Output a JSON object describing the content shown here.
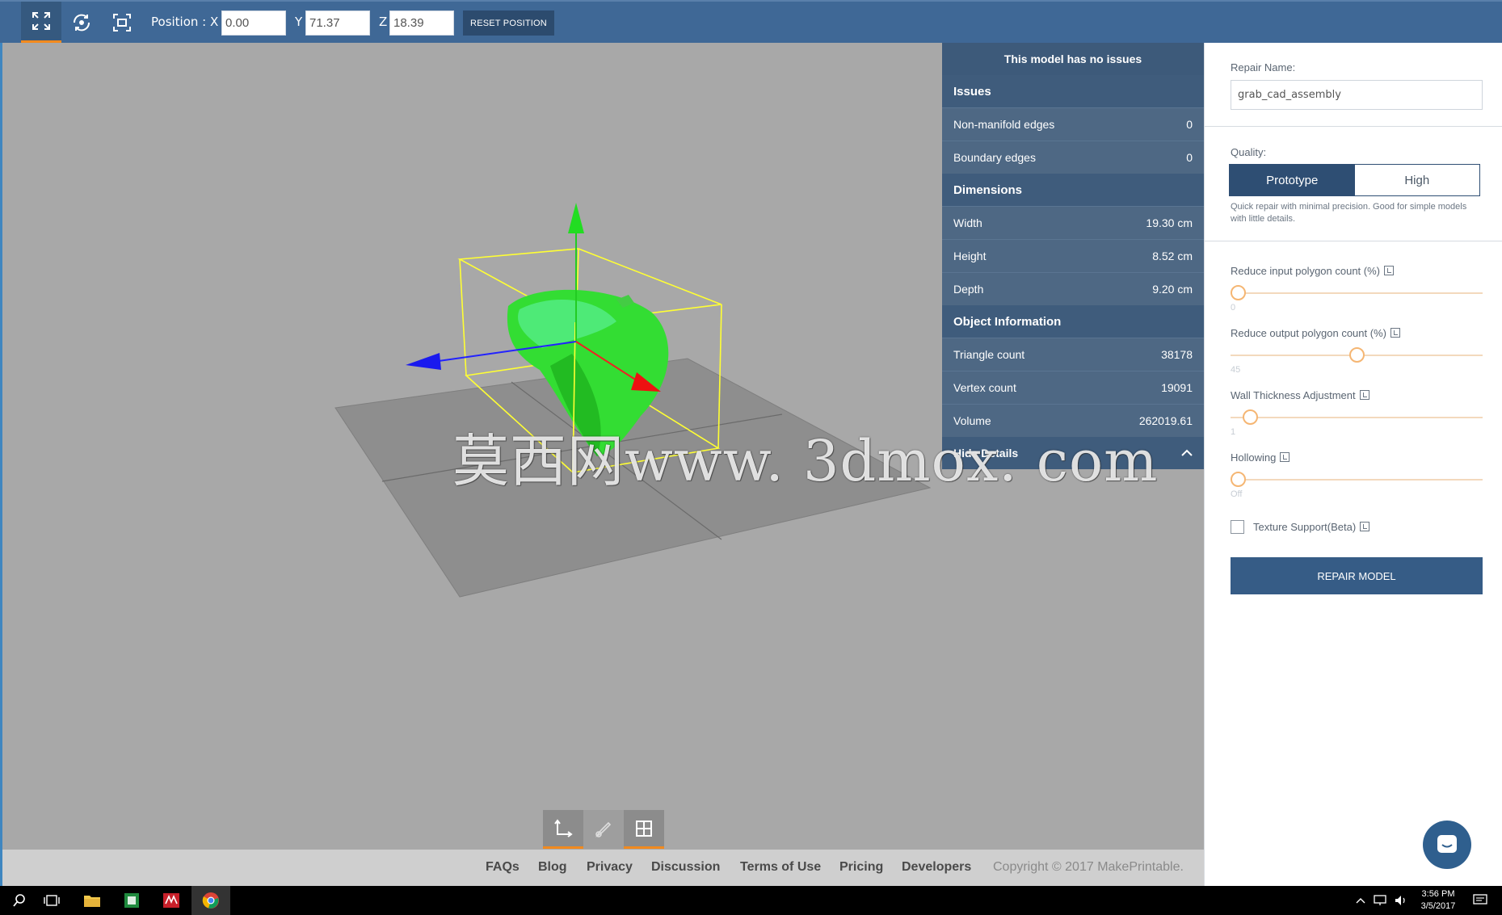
{
  "toolbar": {
    "tools": [
      {
        "icon": "fullscreen-icon",
        "active": true
      },
      {
        "icon": "rotate-icon",
        "active": false
      },
      {
        "icon": "fit-view-icon",
        "active": false
      }
    ],
    "position_label": "Position :",
    "x_label": "X",
    "x_value": "0.00",
    "y_label": "Y",
    "y_value": "71.37",
    "z_label": "Z",
    "z_value": "18.39",
    "reset_label": "RESET POSITION"
  },
  "viewport": {
    "watermark": "莫西网www. 3dmox. com",
    "model_color": "#33dd33",
    "bbox_color": "#ffff33"
  },
  "info_panel": {
    "status": "This model has no issues",
    "issues_header": "Issues",
    "issues": [
      {
        "label": "Non-manifold edges",
        "value": "0"
      },
      {
        "label": "Boundary edges",
        "value": "0"
      }
    ],
    "dimensions_header": "Dimensions",
    "dimensions": [
      {
        "label": "Width",
        "value": "19.30 cm"
      },
      {
        "label": "Height",
        "value": "8.52 cm"
      },
      {
        "label": "Depth",
        "value": "9.20 cm"
      }
    ],
    "object_header": "Object Information",
    "object": [
      {
        "label": "Triangle count",
        "value": "38178"
      },
      {
        "label": "Vertex count",
        "value": "19091"
      },
      {
        "label": "Volume",
        "value": "262019.61"
      }
    ],
    "hide_label": "Hide Details"
  },
  "right_panel": {
    "repair_name_label": "Repair Name:",
    "repair_name_value": "grab_cad_assembly",
    "quality_label": "Quality:",
    "quality_options": [
      "Prototype",
      "High"
    ],
    "quality_selected": "Prototype",
    "quality_desc": "Quick repair with minimal precision. Good for simple models with little details.",
    "sliders": [
      {
        "label": "Reduce input polygon count (%)",
        "value_text": "0",
        "fraction": 0.0
      },
      {
        "label": "Reduce output polygon count (%)",
        "value_text": "45",
        "fraction": 0.5
      },
      {
        "label": "Wall Thickness Adjustment",
        "value_text": "1",
        "fraction": 0.05
      },
      {
        "label": "Hollowing",
        "value_text": "Off",
        "fraction": 0.0
      }
    ],
    "texture_label": "Texture Support(Beta)",
    "texture_checked": false,
    "repair_button": "REPAIR MODEL"
  },
  "view_toggles": [
    {
      "icon": "axes-icon",
      "on": true
    },
    {
      "icon": "paint-icon",
      "on": false
    },
    {
      "icon": "grid-icon",
      "on": true
    }
  ],
  "footer": {
    "links": [
      "FAQs",
      "Blog",
      "Privacy",
      "Discussion",
      "Terms of Use",
      "Pricing",
      "Developers"
    ],
    "copyright": "Copyright © 2017 MakePrintable."
  },
  "taskbar": {
    "time": "3:56 PM",
    "date": "3/5/2017"
  },
  "colors": {
    "toolbar": "#3f6896",
    "accent": "#f28a1e",
    "panel": "#4e6884",
    "button": "#365c86"
  }
}
